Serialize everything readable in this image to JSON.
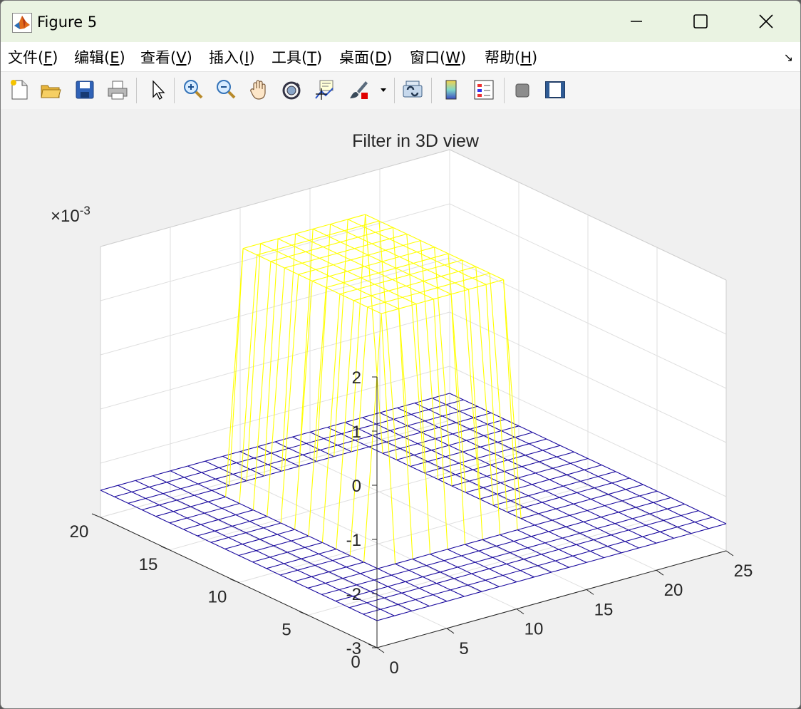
{
  "window": {
    "title": "Figure 5",
    "controls": [
      "minimize",
      "maximize",
      "close"
    ]
  },
  "menu": [
    {
      "label": "文件(",
      "key": "F",
      "tail": ")"
    },
    {
      "label": "编辑(",
      "key": "E",
      "tail": ")"
    },
    {
      "label": "查看(",
      "key": "V",
      "tail": ")"
    },
    {
      "label": "插入(",
      "key": "I",
      "tail": ")"
    },
    {
      "label": "工具(",
      "key": "T",
      "tail": ")"
    },
    {
      "label": "桌面(",
      "key": "D",
      "tail": ")"
    },
    {
      "label": "窗口(",
      "key": "W",
      "tail": ")"
    },
    {
      "label": "帮助(",
      "key": "H",
      "tail": ")"
    }
  ],
  "toolbar": [
    "new-figure-icon",
    "open-file-icon",
    "save-icon",
    "print-icon",
    "pointer-icon",
    "zoom-in-icon",
    "zoom-out-icon",
    "pan-hand-icon",
    "rotate-3d-icon",
    "data-cursor-icon",
    "brush-icon",
    "link-plot-icon",
    "colorbar-icon",
    "legend-icon",
    "hide-plot-tools-icon",
    "show-plot-tools-icon"
  ],
  "chart_data": {
    "type": "mesh3d",
    "title": "Filter in 3D view",
    "z_exponent_label": "×10",
    "z_exponent": "-3",
    "x_ticks": [
      "0",
      "5",
      "10",
      "15",
      "20",
      "25"
    ],
    "y_ticks": [
      "0",
      "5",
      "10",
      "15",
      "20"
    ],
    "z_ticks": [
      "-3",
      "-2",
      "-1",
      "0",
      "1",
      "2"
    ],
    "xlim": [
      0,
      25
    ],
    "ylim": [
      0,
      20
    ],
    "zlim": [
      -0.003,
      0.002
    ],
    "view": "default 3D (azimuth -37.5, elevation 30)",
    "grid": true,
    "surface": {
      "grid_size": 21,
      "high_region": {
        "x_range": [
          6,
          16
        ],
        "y_range": [
          6,
          16
        ],
        "z": 0.002
      },
      "low_region_z": -0.0025,
      "colors": {
        "high": "#ffff00",
        "low": "#1a0a9e"
      }
    }
  }
}
